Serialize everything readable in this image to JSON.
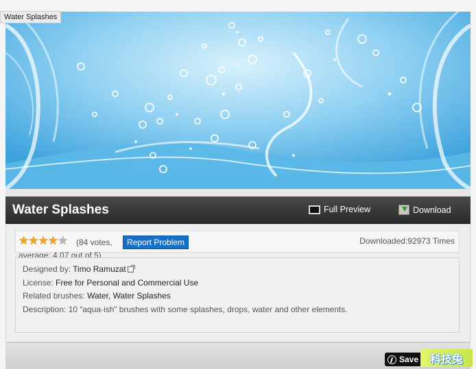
{
  "hero": {
    "tooltip": "Water Splashes",
    "image_name": "water-splashes-banner"
  },
  "header": {
    "title": "Water Splashes",
    "full_preview_label": "Full Preview",
    "download_label": "Download"
  },
  "rating": {
    "stars_filled": 4,
    "stars_total": 5,
    "votes_text": "(84 votes, average: 4.07 out of 5)",
    "report_label": "Report Problem",
    "downloaded_text": "Downloaded:92973 Times"
  },
  "details": {
    "designed_by_label": "Designed by:",
    "designed_by_value": "Timo Ramuzat",
    "license_label": "License:",
    "license_value": "Free for Personal and Commercial Use",
    "related_label": "Related brushes:",
    "related_value": "Water, Water Splashes",
    "description_label": "Description:",
    "description_value": "10 “aqua-ish” brushes with some splashes, drops, water and other elements."
  },
  "footer": {
    "save_label": "Save",
    "watermark_text": "科技兔"
  },
  "colors": {
    "title_bar": "#333333",
    "report_button": "#1670c8",
    "star": "#f2a51c"
  }
}
